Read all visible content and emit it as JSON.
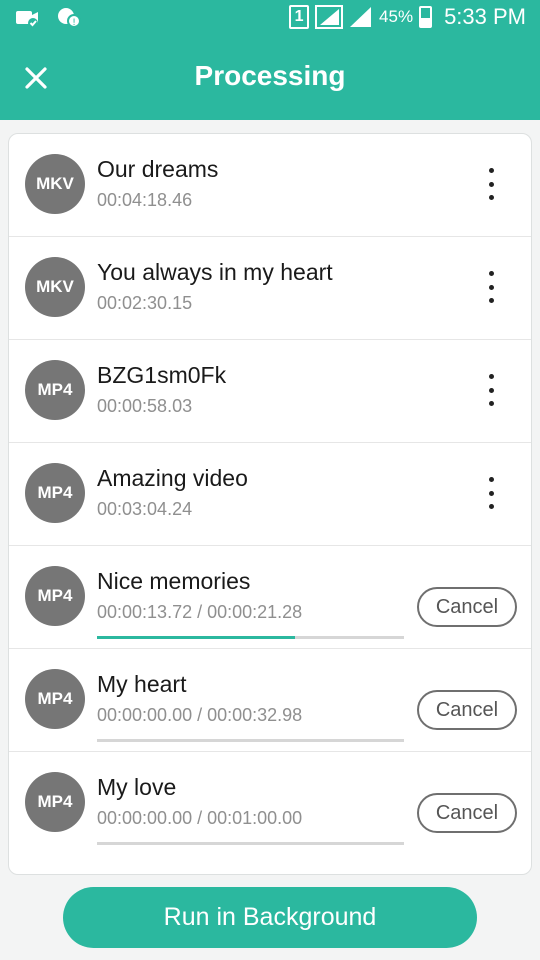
{
  "status_bar": {
    "sim": "1",
    "battery_percent": "45%",
    "battery_level": 0.45,
    "time": "5:33 PM"
  },
  "app_bar": {
    "title": "Processing",
    "close_icon": "close-icon"
  },
  "colors": {
    "accent": "#2bb89f",
    "badge_gray": "#767676",
    "progress_track": "#d6d6d6"
  },
  "items": [
    {
      "format": "MKV",
      "title": "Our dreams",
      "duration": "00:04:18.46"
    },
    {
      "format": "MKV",
      "title": "You always in my heart",
      "duration": "00:02:30.15"
    },
    {
      "format": "MP4",
      "title": "BZG1sm0Fk",
      "duration": "00:00:58.03"
    },
    {
      "format": "MP4",
      "title": "Amazing video",
      "duration": "00:03:04.24"
    },
    {
      "format": "MP4",
      "title": "Nice memories",
      "progress_text": "00:00:13.72 / 00:00:21.28",
      "progress": 0.645,
      "cancel_label": "Cancel"
    },
    {
      "format": "MP4",
      "title": "My heart",
      "progress_text": "00:00:00.00 / 00:00:32.98",
      "progress": 0.0,
      "cancel_label": "Cancel"
    },
    {
      "format": "MP4",
      "title": "My love",
      "progress_text": "00:00:00.00 / 00:01:00.00",
      "progress": 0.0,
      "cancel_label": "Cancel"
    }
  ],
  "run_background_label": "Run in Background"
}
